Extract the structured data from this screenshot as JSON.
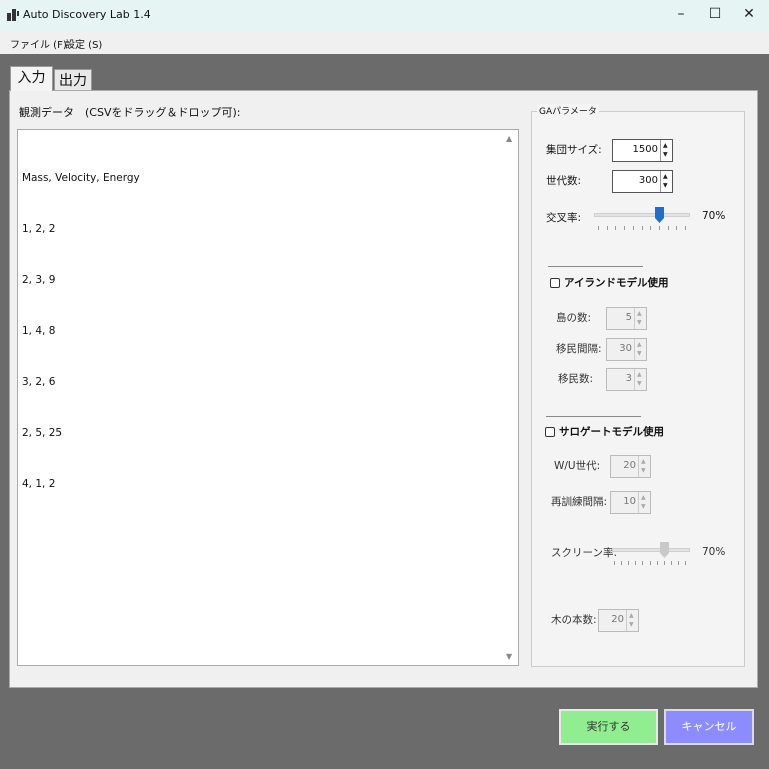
{
  "window": {
    "title": "Auto Discovery Lab 1.4",
    "controls": {
      "minimize": "–",
      "maximize": "☐",
      "close": "✕"
    }
  },
  "menu": {
    "file": "ファイル (F)",
    "settings": "設定 (S)"
  },
  "tabs": [
    {
      "label": "入力",
      "selected": true
    },
    {
      "label": "出力",
      "selected": false
    }
  ],
  "input_tab": {
    "data_label": "観測データ　(CSVをドラッグ＆ドロップ可):",
    "data_lines": [
      "Mass, Velocity, Energy",
      "1, 2, 2",
      "2, 3, 9",
      "1, 4, 8",
      "3, 2, 6",
      "2, 5, 25",
      "4, 1, 2"
    ]
  },
  "ga_params": {
    "title": "GAパラメータ",
    "population_label": "集団サイズ:",
    "population_value": "1500",
    "generations_label": "世代数:",
    "generations_value": "300",
    "crossover_label": "交叉率:",
    "crossover_value_text": "70%",
    "crossover_value": 0.7,
    "island": {
      "checkbox_label": "アイランドモデル使用",
      "checked": false,
      "islands_label": "島の数:",
      "islands_value": "5",
      "migration_interval_label": "移民間隔:",
      "migration_interval_value": "30",
      "migrants_label": "移民数:",
      "migrants_value": "3"
    },
    "surrogate": {
      "checkbox_label": "サロゲートモデル使用",
      "checked": false,
      "warmup_label": "W/U世代:",
      "warmup_value": "20",
      "retrain_label": "再訓練間隔:",
      "retrain_value": "10",
      "screening_label": "スクリーン率:",
      "screening_value_text": "70%",
      "screening_value": 0.7,
      "trees_label": "木の本数:",
      "trees_value": "20"
    }
  },
  "buttons": {
    "run": "実行する",
    "cancel": "キャンセル"
  },
  "colors": {
    "run_button": "#90ee90",
    "cancel_button": "#8c8cff",
    "slider_thumb_active": "#1a6fd1",
    "slider_thumb_disabled": "#c9c9c9",
    "titlebar": "#e6f4f4"
  }
}
